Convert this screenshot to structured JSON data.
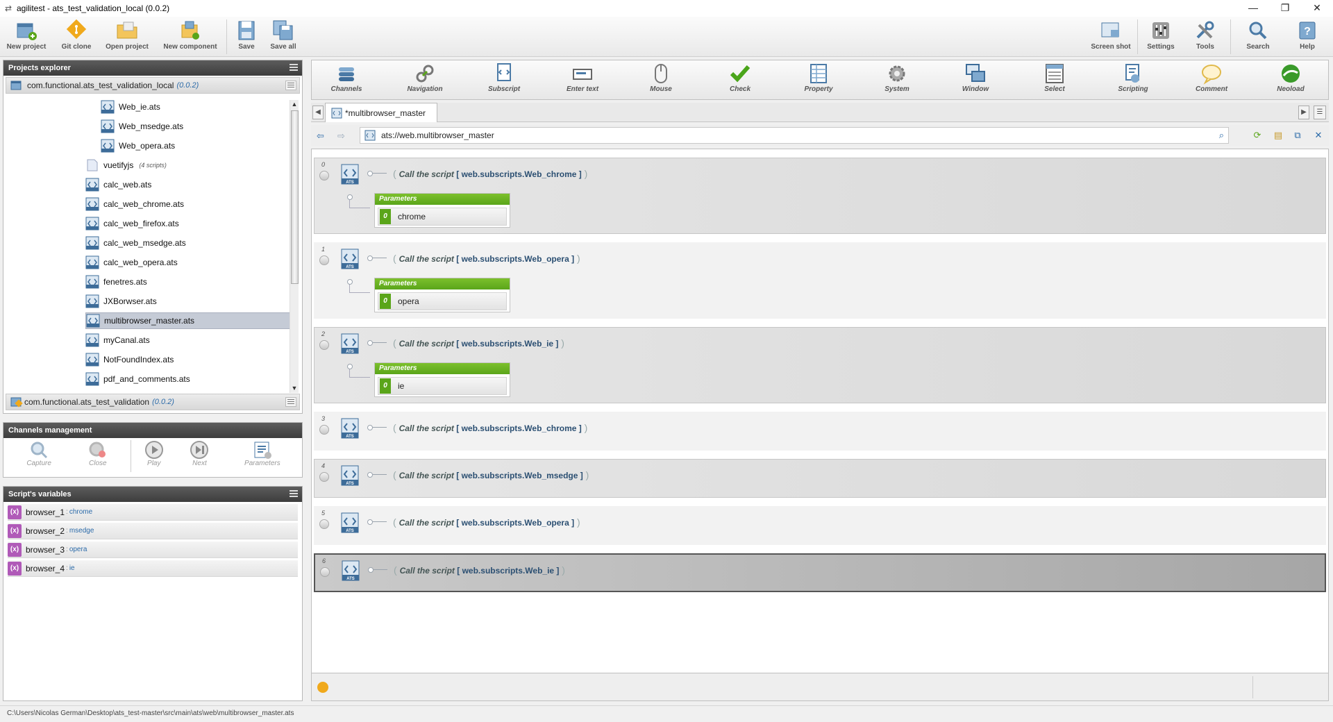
{
  "window": {
    "title": "agilitest - ats_test_validation_local (0.0.2)",
    "controls": [
      "minimize-icon",
      "restore-icon",
      "close-icon"
    ]
  },
  "main_toolbar": {
    "left": [
      {
        "label": "New project",
        "icon": "new-project-icon"
      },
      {
        "label": "Git clone",
        "icon": "git-icon"
      },
      {
        "label": "Open project",
        "icon": "folder-icon"
      },
      {
        "label": "New component",
        "icon": "component-icon"
      },
      {
        "label": "Save",
        "icon": "save-icon"
      },
      {
        "label": "Save all",
        "icon": "save-all-icon"
      }
    ],
    "right": [
      {
        "label": "Screen shot",
        "icon": "screenshot-icon"
      },
      {
        "label": "Settings",
        "icon": "settings-icon"
      },
      {
        "label": "Tools",
        "icon": "tools-icon"
      },
      {
        "label": "Search",
        "icon": "search-icon"
      },
      {
        "label": "Help",
        "icon": "help-icon"
      }
    ]
  },
  "projects_explorer": {
    "title": "Projects explorer",
    "project1": {
      "name": "com.functional.ats_test_validation_local",
      "version": "(0.0.2)"
    },
    "project2": {
      "name": "com.functional.ats_test_validation",
      "version": "(0.0.2)"
    },
    "items": [
      {
        "name": "Web_ie.ats",
        "indent": 2
      },
      {
        "name": "Web_msedge.ats",
        "indent": 2
      },
      {
        "name": "Web_opera.ats",
        "indent": 2
      },
      {
        "name": "vuetifyjs",
        "note": "(4 scripts)",
        "indent": 1,
        "folder": true
      },
      {
        "name": "calc_web.ats",
        "indent": 1
      },
      {
        "name": "calc_web_chrome.ats",
        "indent": 1
      },
      {
        "name": "calc_web_firefox.ats",
        "indent": 1
      },
      {
        "name": "calc_web_msedge.ats",
        "indent": 1
      },
      {
        "name": "calc_web_opera.ats",
        "indent": 1
      },
      {
        "name": "fenetres.ats",
        "indent": 1
      },
      {
        "name": "JXBorwser.ats",
        "indent": 1
      },
      {
        "name": "multibrowser_master.ats",
        "indent": 1,
        "selected": true
      },
      {
        "name": "myCanal.ats",
        "indent": 1
      },
      {
        "name": "NotFoundIndex.ats",
        "indent": 1
      },
      {
        "name": "pdf_and_comments.ats",
        "indent": 1
      }
    ]
  },
  "channels": {
    "title": "Channels management",
    "buttons": [
      {
        "label": "Capture",
        "active": false
      },
      {
        "label": "Close",
        "active": false
      },
      {
        "label": "Play",
        "active": true
      },
      {
        "label": "Next",
        "active": true
      },
      {
        "label": "Parameters",
        "active": true
      }
    ]
  },
  "variables": {
    "title": "Script's variables",
    "items": [
      {
        "icon": "(x)",
        "name": "browser_1",
        "sep": ":",
        "value": "chrome"
      },
      {
        "icon": "(x)",
        "name": "browser_2",
        "sep": ":",
        "value": "msedge"
      },
      {
        "icon": "(x)",
        "name": "browser_3",
        "sep": ":",
        "value": "opera"
      },
      {
        "icon": "(x)",
        "name": "browser_4",
        "sep": ":",
        "value": "ie"
      }
    ]
  },
  "actions_bar": [
    {
      "label": "Channels",
      "icon": "channels-icon"
    },
    {
      "label": "Navigation",
      "icon": "navigation-icon"
    },
    {
      "label": "Subscript",
      "icon": "subscript-icon"
    },
    {
      "label": "Enter text",
      "icon": "enter-text-icon"
    },
    {
      "label": "Mouse",
      "icon": "mouse-icon"
    },
    {
      "label": "Check",
      "icon": "check-icon"
    },
    {
      "label": "Property",
      "icon": "property-icon"
    },
    {
      "label": "System",
      "icon": "system-icon"
    },
    {
      "label": "Window",
      "icon": "window-icon"
    },
    {
      "label": "Select",
      "icon": "select-icon"
    },
    {
      "label": "Scripting",
      "icon": "scripting-icon"
    },
    {
      "label": "Comment",
      "icon": "comment-icon"
    },
    {
      "label": "Neoload",
      "icon": "neoload-icon"
    }
  ],
  "editor": {
    "tab_label": "*multibrowser_master",
    "url": "ats://web.multibrowser_master",
    "params_header": "Parameters",
    "call_text": "Call the script",
    "actions": [
      {
        "index": "0",
        "script": "[ web.subscripts.Web_chrome ]",
        "param_index": "0",
        "param": "chrome",
        "style": "shaded"
      },
      {
        "index": "1",
        "script": "[ web.subscripts.Web_opera ]",
        "param_index": "0",
        "param": "opera",
        "style": "plain"
      },
      {
        "index": "2",
        "script": "[ web.subscripts.Web_ie ]",
        "param_index": "0",
        "param": "ie",
        "style": "shaded"
      },
      {
        "index": "3",
        "script": "[ web.subscripts.Web_chrome ]",
        "style": "plain"
      },
      {
        "index": "4",
        "script": "[ web.subscripts.Web_msedge ]",
        "style": "shaded"
      },
      {
        "index": "5",
        "script": "[ web.subscripts.Web_opera ]",
        "style": "plain"
      },
      {
        "index": "6",
        "script": "[ web.subscripts.Web_ie ]",
        "style": "selected"
      }
    ]
  },
  "status_bar": {
    "path": "C:\\Users\\Nicolas German\\Desktop\\ats_test-master\\src\\main\\ats\\web\\multibrowser_master.ats"
  },
  "colors": {
    "accent_blue": "#2b6aa8",
    "params_green": "#5aa51a",
    "variable_purple": "#b05ab8",
    "panel_header": "#4a4a4a"
  }
}
